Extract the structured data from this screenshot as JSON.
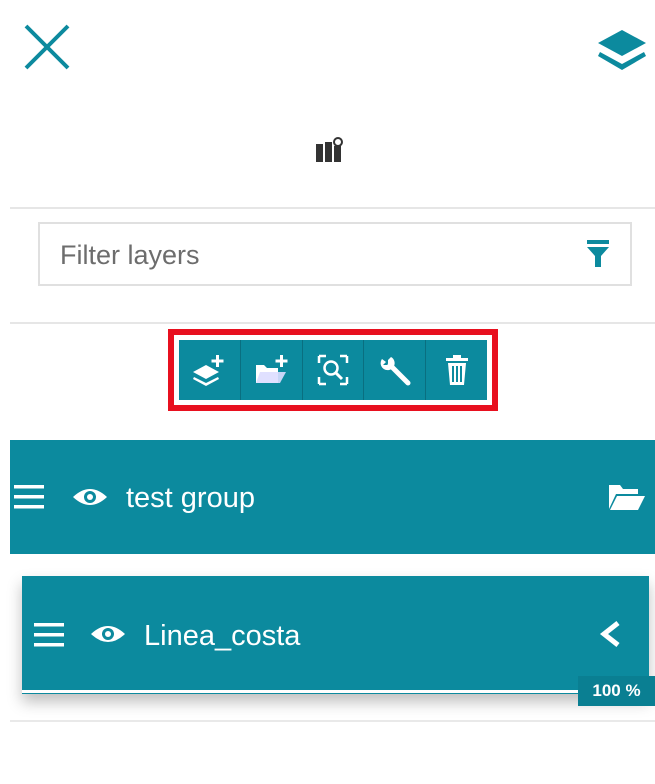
{
  "header": {
    "close_icon": "close-icon",
    "layers_icon": "layers-stack-icon",
    "map_icon": "map-marker-icon"
  },
  "filter": {
    "placeholder": "Filter layers",
    "value": "",
    "icon": "filter-funnel-icon"
  },
  "toolbar": {
    "buttons": [
      {
        "icon": "add-layer-icon"
      },
      {
        "icon": "add-group-folder-icon"
      },
      {
        "icon": "zoom-to-layer-icon"
      },
      {
        "icon": "settings-wrench-icon"
      },
      {
        "icon": "delete-trash-icon"
      }
    ],
    "highlight_color": "#e8101f"
  },
  "layers": [
    {
      "type": "group",
      "label": "test group",
      "visible": true,
      "icon": "folder-open-icon"
    },
    {
      "type": "layer",
      "label": "Linea_costa",
      "visible": true,
      "icon": "chevron-left-icon",
      "opacity": "100 %"
    }
  ],
  "colors": {
    "accent": "#0c8a9e",
    "text_on_accent": "#ffffff"
  }
}
